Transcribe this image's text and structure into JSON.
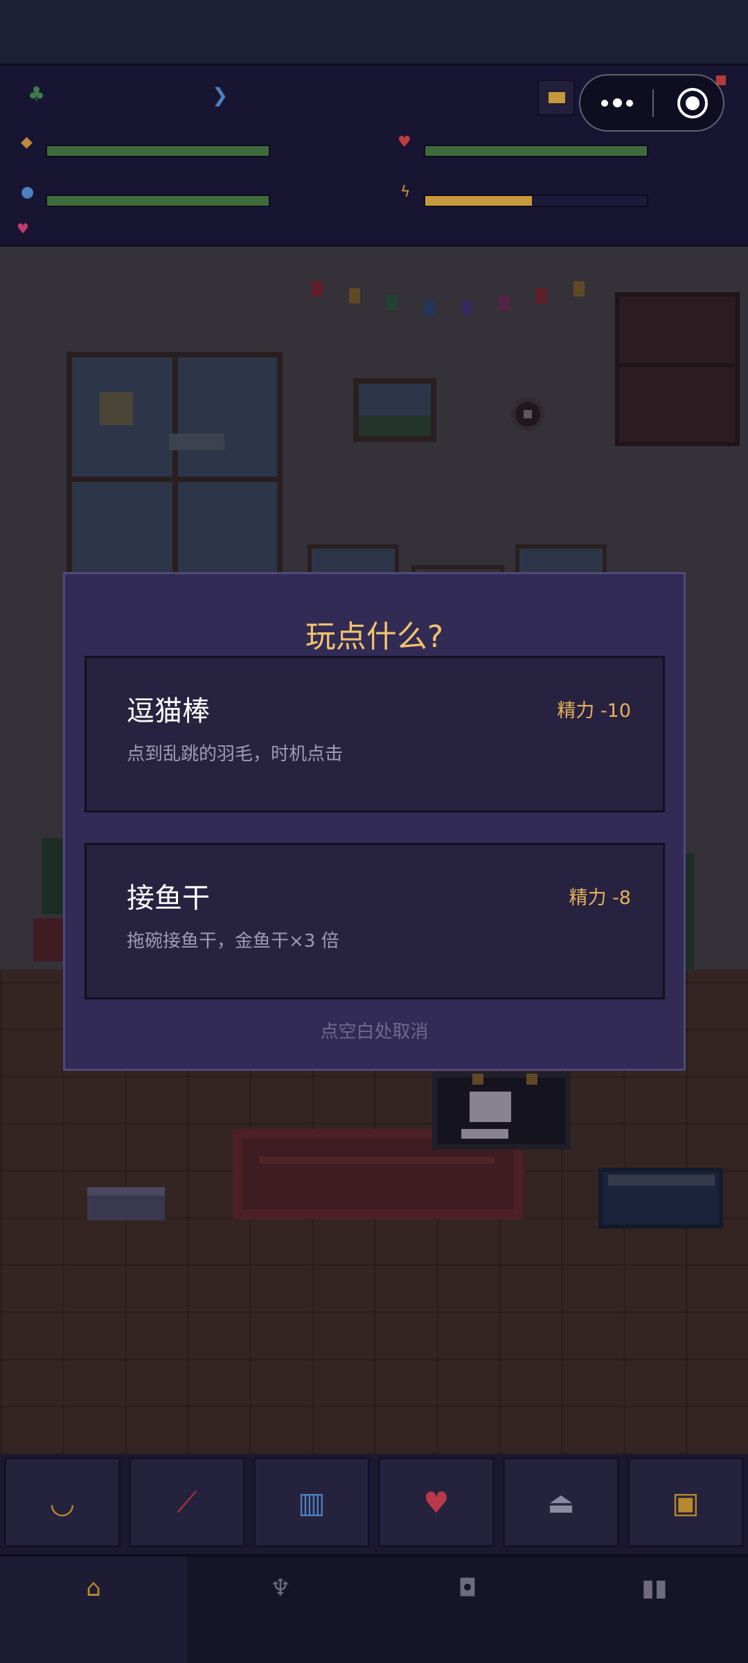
{
  "modal": {
    "title": "玩点什么?",
    "options": [
      {
        "title": "逗猫棒",
        "cost": "精力 -10",
        "desc": "点到乱跳的羽毛，时机点击"
      },
      {
        "title": "接鱼干",
        "cost": "精力 -8",
        "desc": "拖碗接鱼干，金鱼干×3 倍"
      }
    ],
    "cancel_hint": "点空白处取消"
  },
  "stats": {
    "bars": [
      {
        "icon": "cookie-icon",
        "color": "#3f6b3a",
        "level": 1.0
      },
      {
        "icon": "heart-icon",
        "color": "#3f6b3a",
        "level": 1.0
      },
      {
        "icon": "water-drop-icon",
        "color": "#3f6b3a",
        "level": 1.0
      },
      {
        "icon": "lightning-icon",
        "color": "#c69a3a",
        "level": 0.48
      }
    ],
    "header_icons": [
      "plant-icon",
      "fish-icon",
      "radio-icon"
    ],
    "mini_icon": "small-heart-icon"
  },
  "toolbar": {
    "items": [
      "food-bowl-icon",
      "wand-toy-icon",
      "comb-icon",
      "heart-icon",
      "cat-bed-icon",
      "bag-icon"
    ]
  },
  "tabs": {
    "items": [
      "home-icon",
      "trophy-icon",
      "backpack-icon",
      "book-icon"
    ],
    "active": 0
  },
  "colors": {
    "accent": "#f2c46a",
    "modal_bg": "#322b55",
    "card_bg": "#272240",
    "cost": "#e7b15a"
  }
}
